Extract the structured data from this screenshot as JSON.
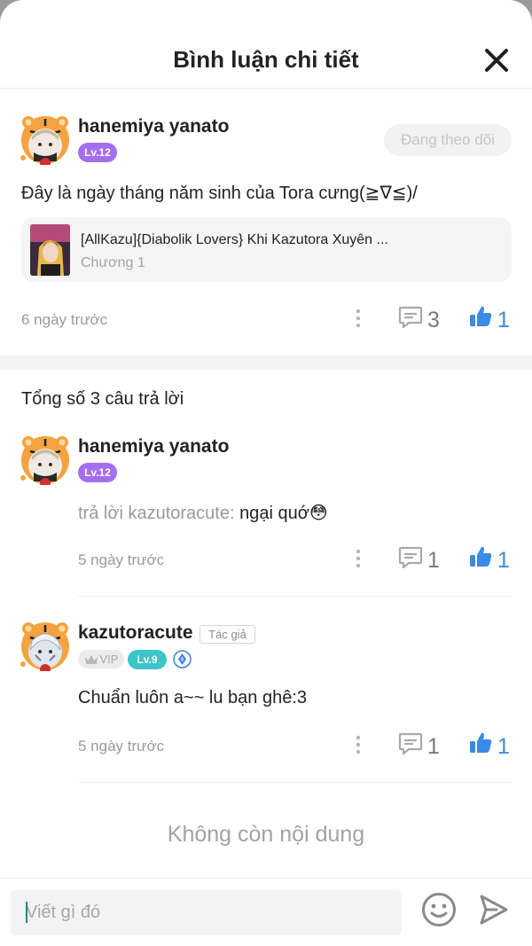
{
  "header": {
    "title": "Bình luận chi tiết"
  },
  "comment": {
    "user_name": "hanemiya yanato",
    "level": "Lv.12",
    "follow_label": "Đang theo dõi",
    "text": "Đây là ngày tháng năm sinh của Tora cưng(≧∇≦)/",
    "chapter": {
      "title": "[AllKazu]{Diabolik Lovers} Khi Kazutora Xuyên ...",
      "subtitle": "Chương 1"
    },
    "time": "6 ngày trước",
    "reply_count": "3",
    "like_count": "1"
  },
  "replies_total": "Tổng số 3 câu trả lời",
  "replies": [
    {
      "user_name": "hanemiya yanato",
      "level": "Lv.12",
      "reply_prefix": "trả lời kazutoracute: ",
      "text": "ngại quớ",
      "emoji": "😳",
      "time": "5 ngày trước",
      "reply_count": "1",
      "like_count": "1"
    },
    {
      "user_name": "kazutoracute",
      "author_tag": "Tác giả",
      "vip_label": "VIP",
      "level": "Lv.9",
      "text": "Chuẩn luôn a~~ lu bạn ghê:3",
      "time": "5 ngày trước",
      "reply_count": "1",
      "like_count": "1"
    }
  ],
  "end_label": "Không còn nội dung",
  "composer": {
    "placeholder": "Viết gì đó"
  },
  "colors": {
    "accent_blue": "#3b8ae6",
    "level_purple": "#a56ef0",
    "level_teal": "#3cc5c9"
  },
  "icons": [
    "close-icon",
    "more-icon",
    "reply-icon",
    "like-icon",
    "vip-crown-icon",
    "diamond-icon",
    "emoji-icon",
    "send-icon"
  ]
}
